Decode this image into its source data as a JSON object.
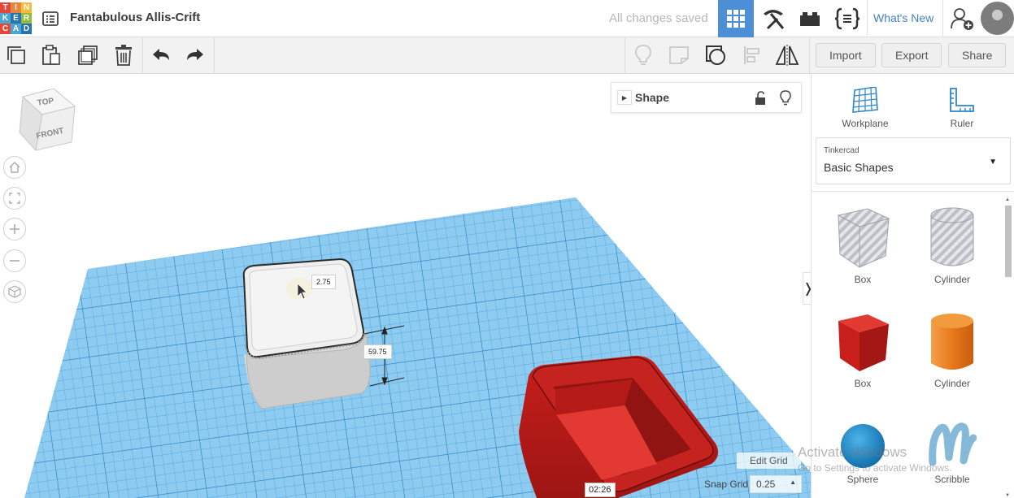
{
  "app": {
    "logo_letters": [
      "T",
      "I",
      "N",
      "K",
      "E",
      "R",
      "C",
      "A",
      "D"
    ],
    "logo_colors": [
      "#e2473a",
      "#e8843b",
      "#f5bc3b",
      "#4da6cf",
      "#2574b0",
      "#8fbf3c",
      "#e2473a",
      "#4da6cf",
      "#2574b0"
    ],
    "document_title": "Fantabulous Allis-Crift",
    "save_status": "All changes saved",
    "whats_new": "What's New"
  },
  "header_icons": [
    "grid-view-icon",
    "pickaxe-icon",
    "brick-icon",
    "codeblocks-icon",
    "add-user-icon",
    "user-avatar"
  ],
  "toolbar": {
    "left_tools": [
      "copy-icon",
      "paste-icon",
      "duplicate-icon",
      "delete-icon",
      "undo-icon",
      "redo-icon"
    ],
    "right_tools": [
      "light-bulb-icon",
      "note-icon",
      "group-icon",
      "align-icon",
      "mirror-icon"
    ],
    "import_label": "Import",
    "export_label": "Export",
    "share_label": "Share"
  },
  "viewcube": {
    "top_label": "TOP",
    "front_label": "FRONT"
  },
  "nav_controls": [
    "home-icon",
    "fit-view-icon",
    "zoom-in-icon",
    "zoom-out-icon",
    "perspective-icon"
  ],
  "inspector": {
    "title": "Shape"
  },
  "scene": {
    "dim_top": "2.75",
    "dim_height": "59.75",
    "timer": "02:26",
    "edit_grid_label": "Edit Grid",
    "snap_grid_label": "Snap Grid",
    "snap_grid_value": "0.25"
  },
  "right_panel": {
    "workplane_label": "Workplane",
    "ruler_label": "Ruler",
    "library_source": "Tinkercad",
    "library_name": "Basic Shapes",
    "shapes": [
      {
        "label": "Box",
        "kind": "box-hole"
      },
      {
        "label": "Cylinder",
        "kind": "cylinder-hole"
      },
      {
        "label": "Box",
        "kind": "box-solid",
        "color": "#d8221f"
      },
      {
        "label": "Cylinder",
        "kind": "cylinder-solid",
        "color": "#e8781c"
      },
      {
        "label": "Sphere",
        "kind": "sphere",
        "color": "#1a8bd0"
      },
      {
        "label": "Scribble",
        "kind": "scribble",
        "color": "#7fb5d6"
      }
    ]
  },
  "watermark": {
    "line1": "Activate Windows",
    "line2": "Go to Settings to activate Windows."
  }
}
